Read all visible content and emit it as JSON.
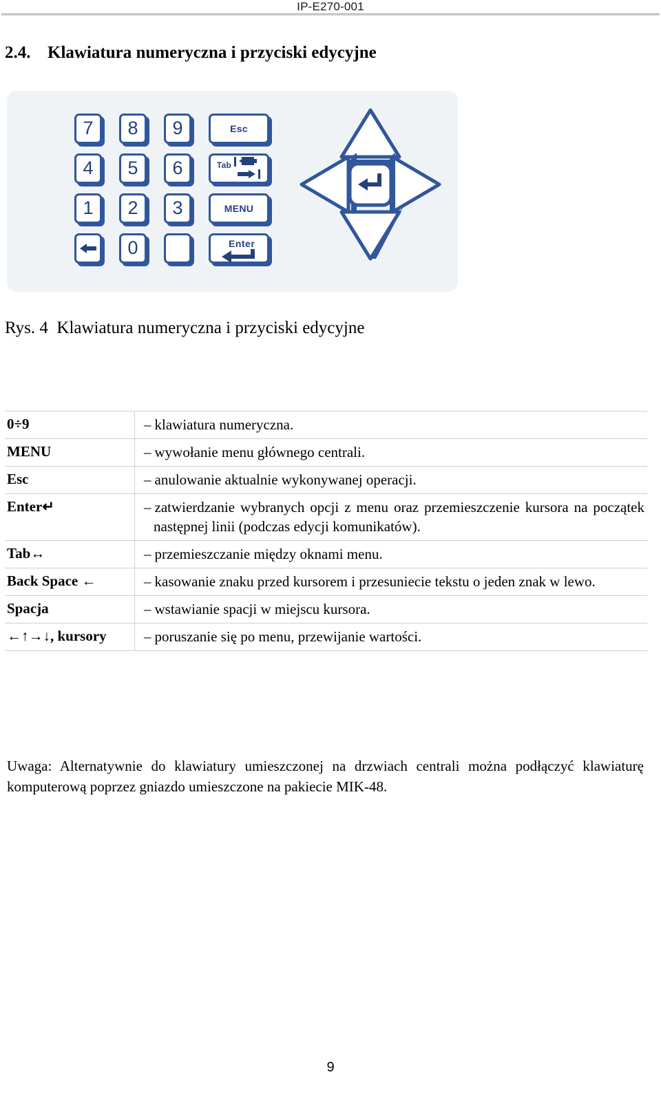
{
  "header": {
    "document_code": "IP-E270-001"
  },
  "section": {
    "number": "2.4.",
    "title": "Klawiatura numeryczna i przyciski edycyjne"
  },
  "figure": {
    "caption_label": "Rys. 4",
    "caption_text": "Klawiatura numeryczna i przyciski edycyjne",
    "colors": {
      "panel_background": "#eff3f6",
      "key_outline": "#31569b",
      "key_fill": "#ffffff",
      "glyph": "#24417c"
    },
    "keypad_rows": [
      [
        "7",
        "8",
        "9",
        "Esc"
      ],
      [
        "4",
        "5",
        "6",
        "Tab"
      ],
      [
        "1",
        "2",
        "3",
        "MENU"
      ],
      [
        "←",
        "0",
        "",
        "Enter"
      ]
    ],
    "keys": {
      "k7": "7",
      "k8": "8",
      "k9": "9",
      "kesc": "Esc",
      "k4": "4",
      "k5": "5",
      "k6": "6",
      "ktab": "Tab",
      "k1": "1",
      "k2": "2",
      "k3": "3",
      "kmenu": "MENU",
      "kback": "←",
      "k0": "0",
      "kblank": "",
      "kenter": "Enter"
    },
    "cluster": {
      "up": "up-arrow-key",
      "down": "down-arrow-key",
      "left": "left-arrow-key",
      "right": "right-arrow-key",
      "center": "enter-key"
    }
  },
  "key_table": {
    "rows": [
      {
        "key": "0÷9",
        "description": "klawiatura numeryczna."
      },
      {
        "key": "MENU",
        "description": "wywołanie menu głównego centrali."
      },
      {
        "key": "Esc",
        "description": "anulowanie aktualnie wykonywanej operacji."
      },
      {
        "key": "Enter↵",
        "description": "zatwierdzanie wybranych opcji z menu oraz przemieszczenie kursora na początek następnej linii (podczas edycji komunikatów)."
      },
      {
        "key": "Tab↔",
        "description": "przemieszczanie między oknami menu."
      },
      {
        "key": "Back Space ←",
        "description": "kasowanie znaku przed kursorem i przesuniecie tekstu o jeden znak w lewo."
      },
      {
        "key": "Spacja",
        "description": "wstawianie spacji w miejscu kursora."
      },
      {
        "key": "←↑→↓, kursory",
        "description": "poruszanie się po menu, przewijanie wartości."
      }
    ],
    "dash": "–"
  },
  "note": {
    "text": "Uwaga: Alternatywnie do klawiatury umieszczonej na drzwiach centrali można podłączyć klawiaturę komputerową poprzez gniazdo umieszczone na pakiecie MIK-48."
  },
  "footer": {
    "page_number": "9"
  }
}
